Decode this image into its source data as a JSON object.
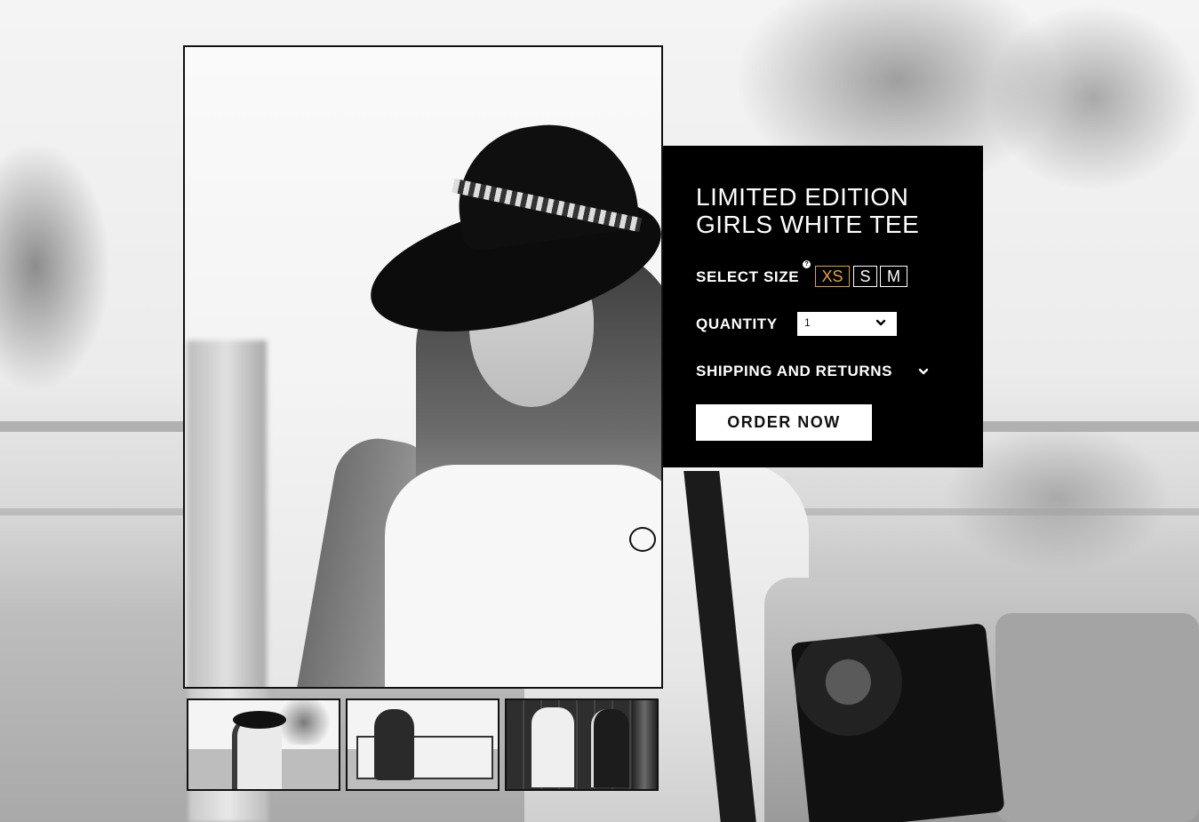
{
  "product": {
    "title_line1": "LIMITED EDITION",
    "title_line2": "GIRLS WHITE TEE"
  },
  "size": {
    "label": "SELECT SIZE",
    "help_glyph": "?",
    "options": [
      "XS",
      "S",
      "M"
    ],
    "selected": "XS"
  },
  "quantity": {
    "label": "QUANTITY",
    "value": "1"
  },
  "shipping": {
    "label": "SHIPPING AND RETURNS"
  },
  "order": {
    "label": "ORDER NOW"
  },
  "colors": {
    "panel_bg": "#000000",
    "selected_size": "#e6a23c",
    "text": "#ffffff"
  },
  "icons": {
    "quantity_dropdown": "chevron-down-icon",
    "shipping_toggle": "chevron-down-icon",
    "size_help": "help-icon"
  }
}
